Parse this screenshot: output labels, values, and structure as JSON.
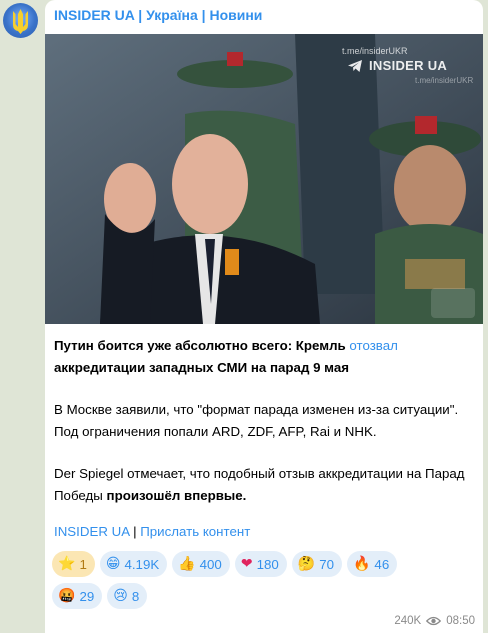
{
  "channel": {
    "name": "INSIDER UA | Україна | Новини"
  },
  "watermark": {
    "url": "t.me/insiderUKR",
    "logo_text": "INSIDER UA",
    "url_small": "t.me/insiderUKR"
  },
  "post": {
    "p1_bold_a": "Путин боится уже абсолютно всего: Кремль ",
    "p1_link": "отозвал",
    "p1_bold_b": " аккредитации западных СМИ на парад 9 мая",
    "p2": "В Москве заявили, что \"формат парада изменен из-за ситуации\". Под ограничения попали ARD, ZDF, AFP, Rai и NHK.",
    "p3_a": "Der Spiegel отмечает, что подобный отзыв аккредитации на Парад Победы ",
    "p3_bold": "произошёл впервые."
  },
  "footer": {
    "link1": "INSIDER UA",
    "sep": " | ",
    "link2": "Прислать контент"
  },
  "reactions": [
    {
      "emoji": "⭐",
      "count": "1",
      "active": true
    },
    {
      "emoji": "😁",
      "count": "4.19K"
    },
    {
      "emoji": "👍",
      "count": "400"
    },
    {
      "emoji": "❤",
      "count": "180"
    },
    {
      "emoji": "🤔",
      "count": "70"
    },
    {
      "emoji": "🔥",
      "count": "46"
    },
    {
      "emoji": "🤬",
      "count": "29"
    },
    {
      "emoji": "😢",
      "count": "8"
    }
  ],
  "meta": {
    "views": "240K",
    "time": "08:50",
    "eye_icon": "eye-icon"
  },
  "colors": {
    "accent": "#3390ec",
    "background": "#dfe5d6",
    "bubble": "#ffffff",
    "reaction_bg": "#e3eef9",
    "star_bg": "#fbe6b3"
  }
}
